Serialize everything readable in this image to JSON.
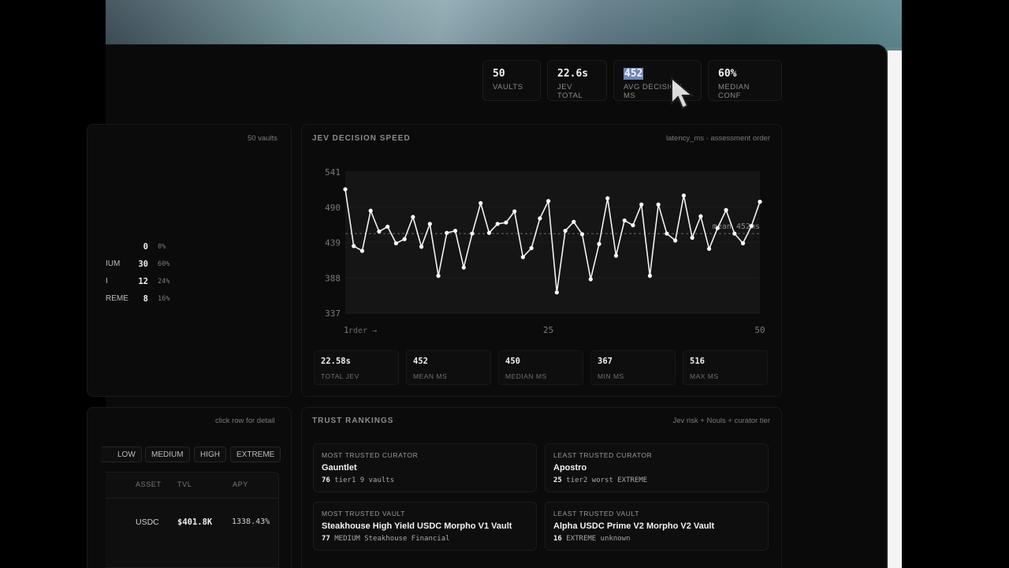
{
  "stats": [
    {
      "value": "50",
      "label": "VAULTS"
    },
    {
      "value": "22.6s",
      "label": "JEV TOTAL"
    },
    {
      "value": "452",
      "label": "AVG DECISION MS"
    },
    {
      "value": "60%",
      "label": "MEDIAN CONF"
    }
  ],
  "left_panel": {
    "note": "50 vaults",
    "risk_rows": [
      {
        "name": "",
        "count": "0",
        "pct": "0%"
      },
      {
        "name": "IUM",
        "count": "30",
        "pct": "60%"
      },
      {
        "name": "I",
        "count": "12",
        "pct": "24%"
      },
      {
        "name": "REME",
        "count": "8",
        "pct": "16%"
      }
    ]
  },
  "speed_panel": {
    "title": "JEV DECISION SPEED",
    "note": "latency_ms · assessment order",
    "mean_label": "mean 452ms",
    "x_axis_label": "order →",
    "summary": [
      {
        "value": "22.58s",
        "label": "TOTAL JEV"
      },
      {
        "value": "452",
        "label": "MEAN MS"
      },
      {
        "value": "450",
        "label": "MEDIAN MS"
      },
      {
        "value": "367",
        "label": "MIN MS"
      },
      {
        "value": "516",
        "label": "MAX MS"
      }
    ]
  },
  "chart_data": {
    "type": "line",
    "x": [
      1,
      2,
      3,
      4,
      5,
      6,
      7,
      8,
      9,
      10,
      11,
      12,
      13,
      14,
      15,
      16,
      17,
      18,
      19,
      20,
      21,
      22,
      23,
      24,
      25,
      26,
      27,
      28,
      29,
      30,
      31,
      32,
      33,
      34,
      35,
      36,
      37,
      38,
      39,
      40,
      41,
      42,
      43,
      44,
      45,
      46,
      47,
      48,
      49,
      50
    ],
    "y": [
      516,
      434,
      427,
      485,
      455,
      462,
      438,
      444,
      476,
      433,
      466,
      391,
      453,
      456,
      403,
      452,
      496,
      453,
      466,
      468,
      484,
      418,
      431,
      474,
      499,
      367,
      456,
      469,
      451,
      386,
      437,
      503,
      420,
      471,
      464,
      494,
      391,
      494,
      452,
      442,
      507,
      446,
      477,
      430,
      460,
      486,
      452,
      438,
      463,
      498
    ],
    "xlim": [
      1,
      50
    ],
    "ylim": [
      337,
      541
    ],
    "yticks": [
      541,
      490,
      439,
      388,
      337
    ],
    "xticks": [
      1,
      25,
      50
    ],
    "mean": 452,
    "xlabel": "order →",
    "ylabel": "",
    "grid": true,
    "colors": {
      "line": "#f2f2f2",
      "mean": "#6b6b6b",
      "area": "#151515"
    }
  },
  "table_panel": {
    "note": "click row for detail",
    "filters": [
      "LOW",
      "MEDIUM",
      "HIGH",
      "EXTREME"
    ],
    "columns": [
      "ASSET",
      "TVL",
      "APY"
    ],
    "rows": [
      {
        "asset": "USDC",
        "tvl": "$401.8K",
        "apy": "1338.43%"
      }
    ]
  },
  "trust_panel": {
    "title": "TRUST RANKINGS",
    "note": "Jev risk + Nouls + curator tier",
    "cards": [
      {
        "kind": "MOST TRUSTED CURATOR",
        "name": "Gauntlet",
        "score": "76",
        "meta": "tier1 9 vaults"
      },
      {
        "kind": "LEAST TRUSTED CURATOR",
        "name": "Apostro",
        "score": "25",
        "meta": "tier2 worst EXTREME"
      },
      {
        "kind": "MOST TRUSTED VAULT",
        "name": "Steakhouse High Yield USDC Morpho V1 Vault",
        "score": "77",
        "meta": "MEDIUM Steakhouse Financial"
      },
      {
        "kind": "LEAST TRUSTED VAULT",
        "name": "Alpha USDC Prime V2 Morpho V2 Vault",
        "score": "16",
        "meta": "EXTREME unknown"
      }
    ]
  }
}
